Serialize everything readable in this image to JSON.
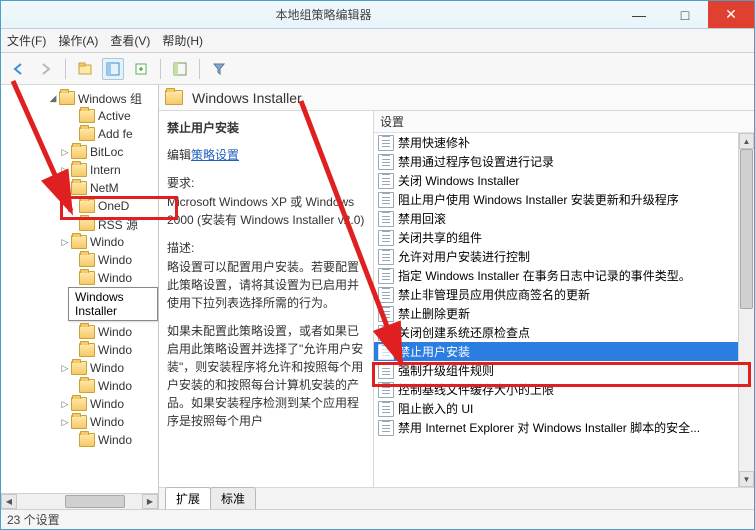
{
  "window": {
    "title": "本地组策略编辑器",
    "minimize": "—",
    "maximize": "□",
    "close": "✕"
  },
  "menu": {
    "file": "文件(F)",
    "action": "操作(A)",
    "view": "查看(V)",
    "help": "帮助(H)"
  },
  "tree": {
    "items": [
      {
        "indent": 46,
        "caret": "◢",
        "label": "Windows 组"
      },
      {
        "indent": 66,
        "caret": "",
        "label": "Active"
      },
      {
        "indent": 66,
        "caret": "",
        "label": "Add fe"
      },
      {
        "indent": 58,
        "caret": "▷",
        "label": "BitLoc"
      },
      {
        "indent": 58,
        "caret": "▷",
        "label": "Intern"
      },
      {
        "indent": 58,
        "caret": "▷",
        "label": "NetM"
      },
      {
        "indent": 66,
        "caret": "",
        "label": "OneD"
      },
      {
        "indent": 66,
        "caret": "",
        "label": "RSS 源"
      },
      {
        "indent": 58,
        "caret": "▷",
        "label": "Windo"
      },
      {
        "indent": 66,
        "caret": "",
        "label": "Windo"
      },
      {
        "indent": 66,
        "caret": "",
        "label": "Windo"
      },
      {
        "indent": 66,
        "caret": "",
        "label": "Windo"
      },
      {
        "indent": 66,
        "caret": "",
        "label": "Windo"
      },
      {
        "indent": 66,
        "caret": "",
        "label": "Windo"
      },
      {
        "indent": 66,
        "caret": "",
        "label": "Windo"
      },
      {
        "indent": 58,
        "caret": "▷",
        "label": "Windo"
      },
      {
        "indent": 66,
        "caret": "",
        "label": "Windo"
      },
      {
        "indent": 58,
        "caret": "▷",
        "label": "Windo"
      },
      {
        "indent": 58,
        "caret": "▷",
        "label": "Windo"
      },
      {
        "indent": 66,
        "caret": "",
        "label": "Windo"
      }
    ],
    "tooltip": "Windows Installer"
  },
  "header": {
    "title": "Windows Installer"
  },
  "details": {
    "title": "禁止用户安装",
    "edit_prefix": "编辑",
    "edit_link": "策略设置",
    "req_label": "要求:",
    "req_text": "Microsoft Windows XP 或 Windows 2000 (安装有 Windows Installer v2.0)",
    "desc_label": "描述:",
    "desc_text": "略设置可以配置用户安装。若要配置此策略设置，请将其设置为已启用并使用下拉列表选择所需的行为。",
    "desc_text2": "如果未配置此策略设置，或者如果已启用此策略设置并选择了\"允许用户安装\"，则安装程序将允许和按照每个用户安装的和按照每台计算机安装的产品。如果安装程序检测到某个应用程序是按照每个用户"
  },
  "settings": {
    "header": "设置",
    "items": [
      "禁用快速修补",
      "禁用通过程序包设置进行记录",
      "关闭 Windows Installer",
      "阻止用户使用 Windows Installer 安装更新和升级程序",
      "禁用回滚",
      "关闭共享的组件",
      "允许对用户安装进行控制",
      "指定 Windows Installer 在事务日志中记录的事件类型。",
      "禁止非管理员应用供应商签名的更新",
      "禁止删除更新",
      "关闭创建系统还原检查点",
      "禁止用户安装",
      "强制升级组件规则",
      "控制基线文件缓存大小的上限",
      "阻止嵌入的 UI",
      "禁用 Internet Explorer 对 Windows Installer 脚本的安全..."
    ],
    "selected_index": 11
  },
  "tabs": {
    "extended": "扩展",
    "standard": "标准"
  },
  "status": "23 个设置"
}
